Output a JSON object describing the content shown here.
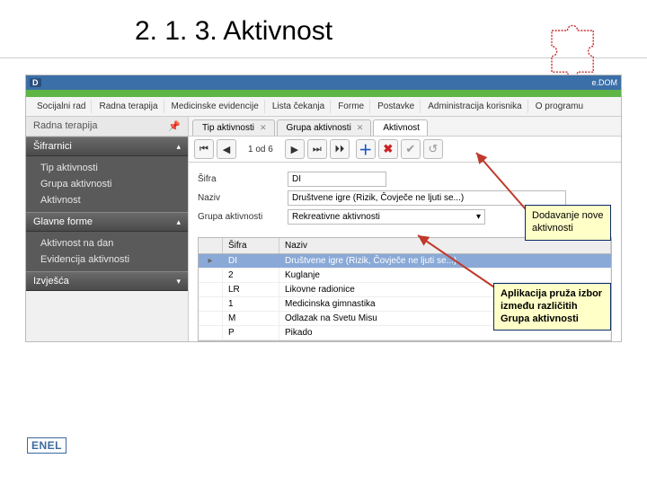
{
  "slide": {
    "title": "2. 1. 3. Aktivnost"
  },
  "app": {
    "title_left": "D",
    "title_right": "e.DOM",
    "menu": [
      "Socijalni rad",
      "Radna terapija",
      "Medicinske evidencije",
      "Lista čekanja",
      "Forme",
      "Postavke",
      "Administracija korisnika",
      "O programu"
    ]
  },
  "sidebar": {
    "header": "Radna terapija",
    "pin": "📌",
    "sections": [
      {
        "title": "Šifrarnici",
        "open": true,
        "items": [
          "Tip aktivnosti",
          "Grupa aktivnosti",
          "Aktivnost"
        ]
      },
      {
        "title": "Glavne forme",
        "open": true,
        "items": [
          "Aktivnost na dan",
          "Evidencija aktivnosti"
        ]
      },
      {
        "title": "Izvješća",
        "open": false,
        "items": []
      }
    ]
  },
  "tabs": [
    {
      "label": "Tip aktivnosti",
      "closable": true,
      "active": false
    },
    {
      "label": "Grupa aktivnosti",
      "closable": true,
      "active": false
    },
    {
      "label": "Aktivnost",
      "closable": false,
      "active": true
    }
  ],
  "toolbar": {
    "position": "1 od 6"
  },
  "form": {
    "sifra": {
      "label": "Šifra",
      "value": "DI"
    },
    "naziv": {
      "label": "Naziv",
      "value": "Društvene igre (Rizik, Čovječe ne ljuti se...)"
    },
    "grupa": {
      "label": "Grupa aktivnosti",
      "value": "Rekreativne aktivnosti"
    }
  },
  "grid": {
    "headers": [
      "",
      "Šifra",
      "Naziv"
    ],
    "rows": [
      {
        "mark": "▸",
        "sifra": "DI",
        "naziv": "Društvene igre (Rizik, Čovječe ne ljuti se...)",
        "selected": true
      },
      {
        "mark": "",
        "sifra": "2",
        "naziv": "Kuglanje"
      },
      {
        "mark": "",
        "sifra": "LR",
        "naziv": "Likovne radionice"
      },
      {
        "mark": "",
        "sifra": "1",
        "naziv": "Medicinska gimnastika"
      },
      {
        "mark": "",
        "sifra": "M",
        "naziv": "Odlazak na Svetu Misu"
      },
      {
        "mark": "",
        "sifra": "P",
        "naziv": "Pikado"
      }
    ]
  },
  "callouts": {
    "c1": "Dodavanje nove aktivnosti",
    "c2": "Aplikacija pruža izbor između različitih Grupa aktivnosti"
  },
  "logo": "ENEL"
}
